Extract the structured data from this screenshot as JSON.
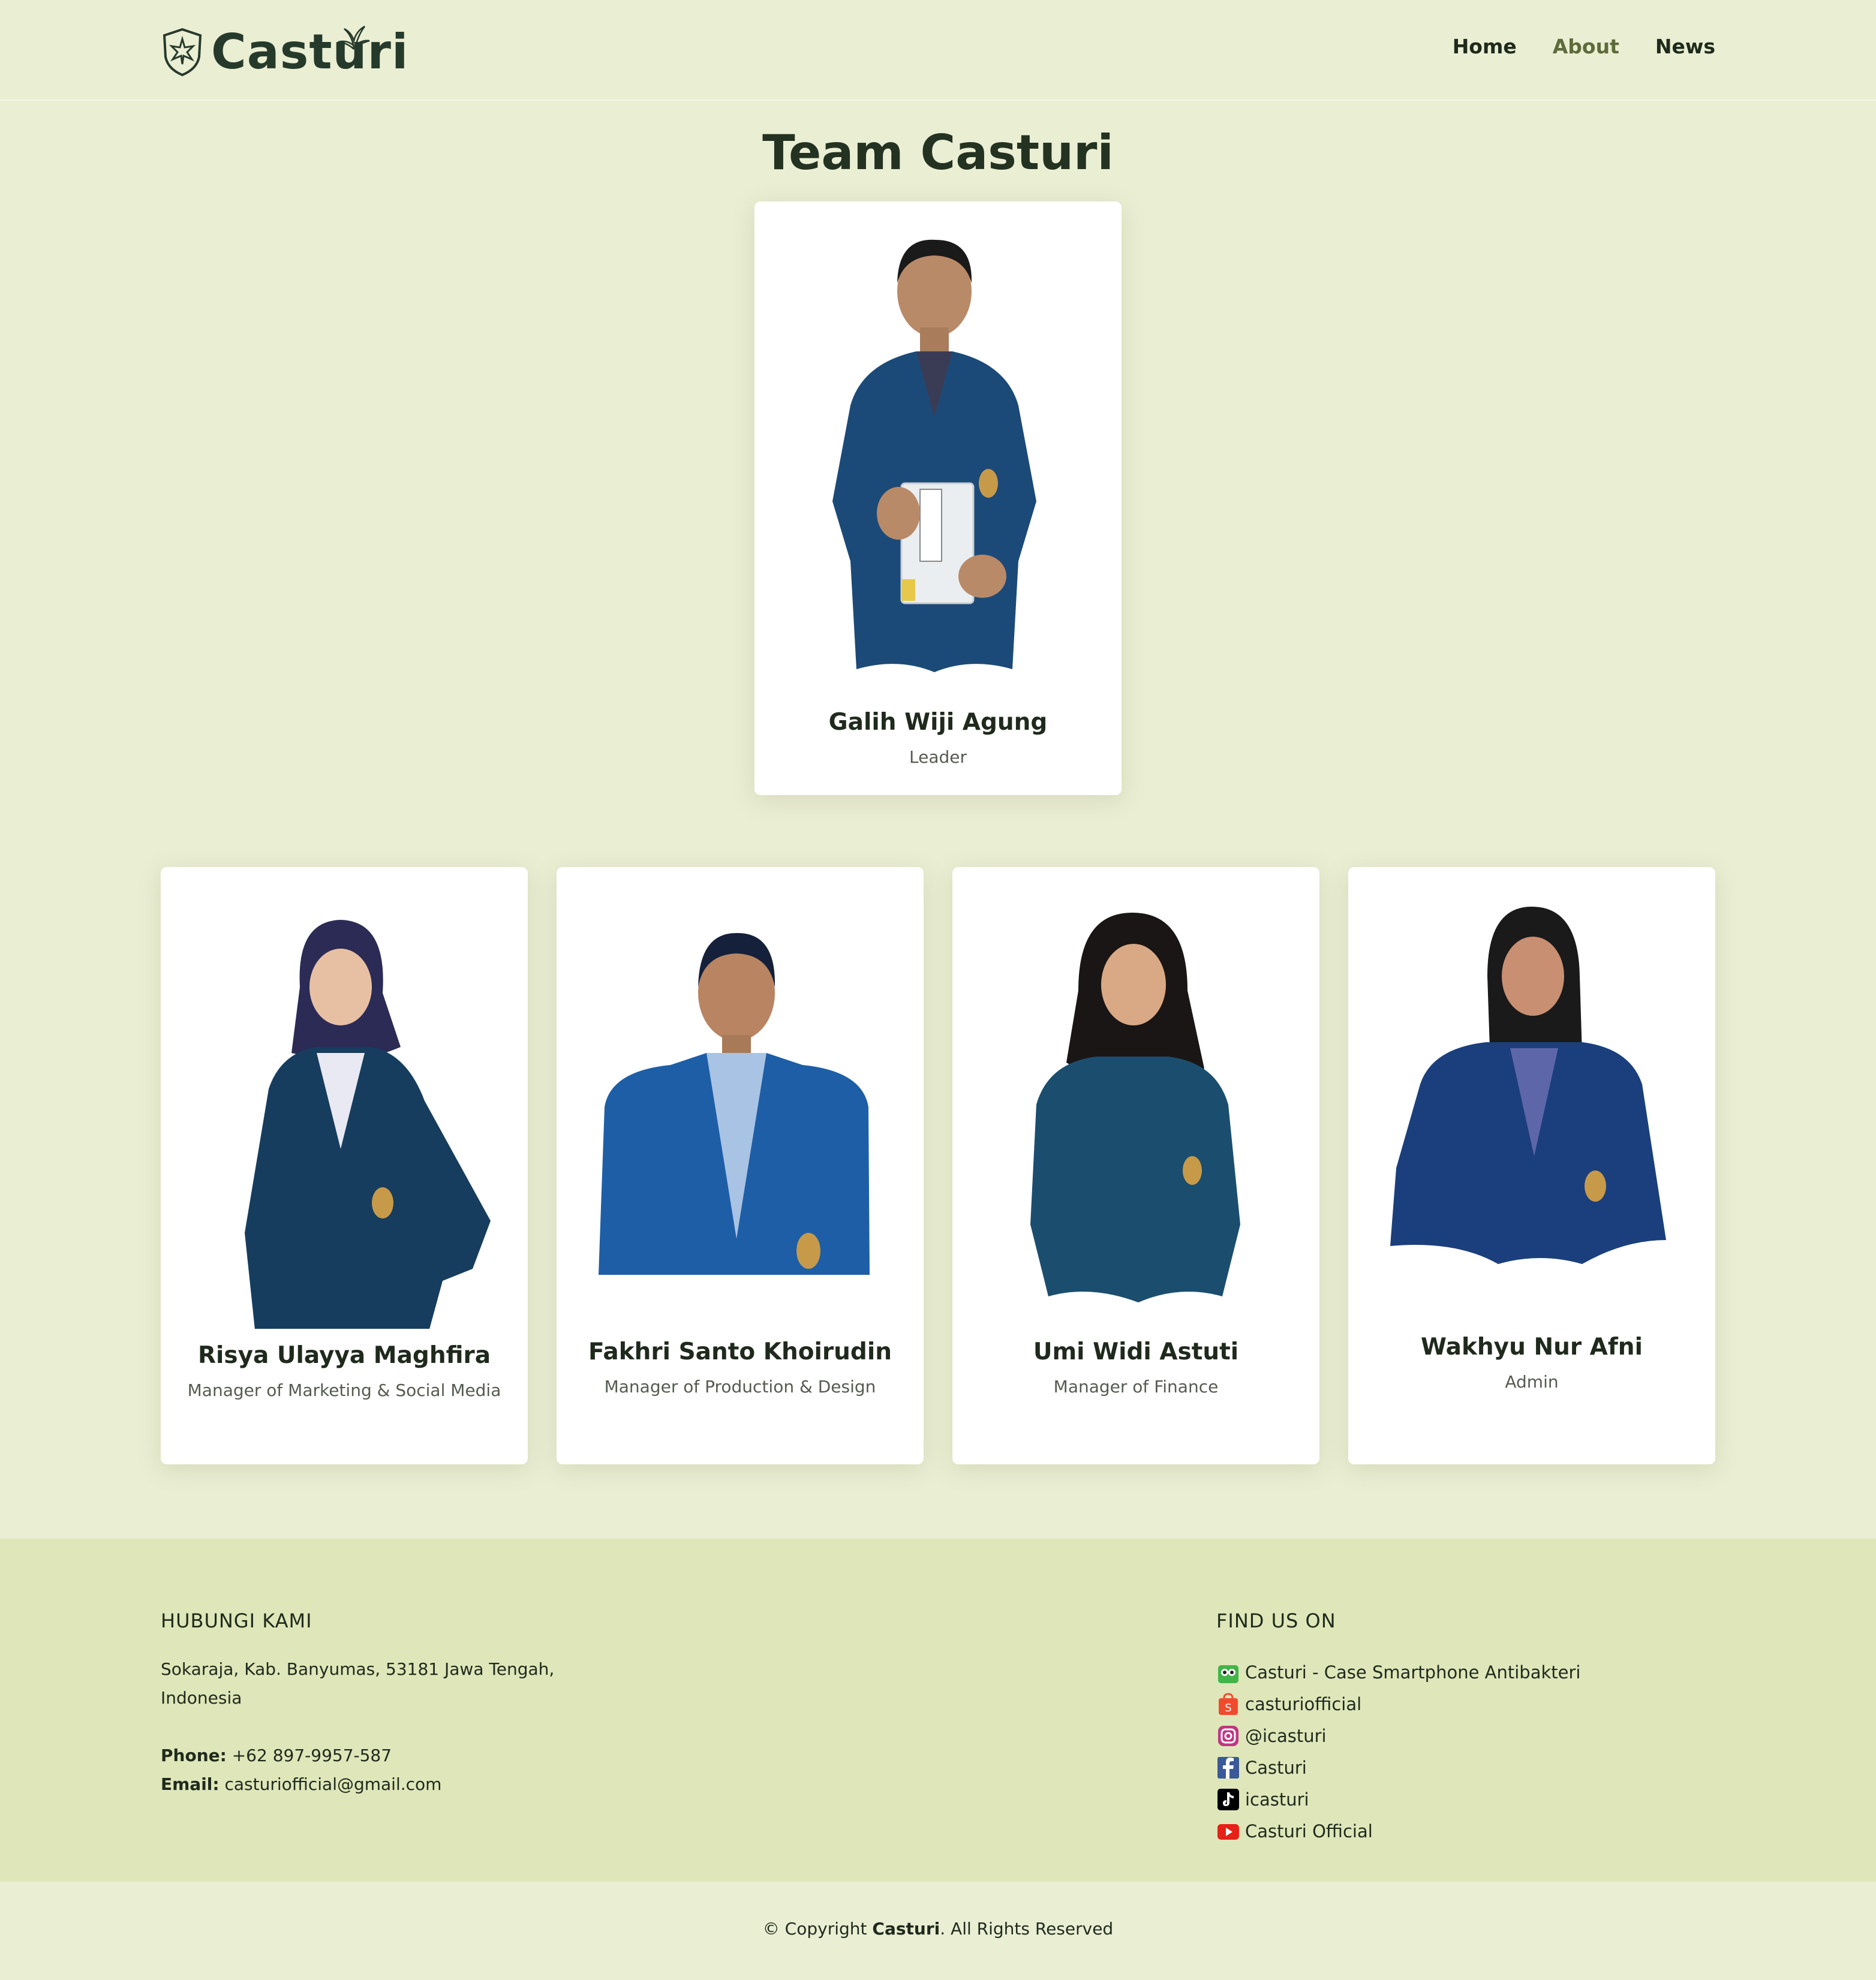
{
  "brand": {
    "name": "Casturi"
  },
  "nav": {
    "items": [
      "Home",
      "About",
      "News"
    ],
    "active": "About"
  },
  "page": {
    "title": "Team Casturi"
  },
  "team": [
    {
      "name": "Galih Wiji Agung",
      "role": "Leader"
    },
    {
      "name": "Risya Ulayya Maghfira",
      "role": "Manager of Marketing & Social Media"
    },
    {
      "name": "Fakhri Santo Khoirudin",
      "role": "Manager of Production & Design"
    },
    {
      "name": "Umi Widi Astuti",
      "role": "Manager of Finance"
    },
    {
      "name": "Wakhyu Nur Afni",
      "role": "Admin"
    }
  ],
  "footer": {
    "contact_title": "HUBUNGI KAMI",
    "address_line1": "Sokaraja, Kab. Banyumas, 53181 Jawa Tengah,",
    "address_line2": "Indonesia",
    "phone_label": "Phone:",
    "phone": "+62 897-9957-587",
    "email_label": "Email:",
    "email": "casturiofficial@gmail.com",
    "social_title": "FIND US ON",
    "social": [
      {
        "icon": "tokopedia-icon",
        "label": "Casturi - Case Smartphone Antibakteri",
        "color": "#42b549"
      },
      {
        "icon": "shopee-icon",
        "label": "casturiofficial",
        "color": "#ee4d2d"
      },
      {
        "icon": "instagram-icon",
        "label": "@icasturi",
        "color": "#c13584"
      },
      {
        "icon": "facebook-icon",
        "label": "Casturi",
        "color": "#3b5998"
      },
      {
        "icon": "tiktok-icon",
        "label": "icasturi",
        "color": "#000000"
      },
      {
        "icon": "youtube-icon",
        "label": "Casturi Official",
        "color": "#e62117"
      }
    ]
  },
  "copyright": {
    "prefix": "© Copyright",
    "brand": "Casturi",
    "suffix": ". All Rights Reserved"
  },
  "colors": {
    "background": "#eaeed3",
    "footer": "#dfe6b9",
    "accent": "#5e6b3a",
    "jacket": "#1c4a78"
  }
}
